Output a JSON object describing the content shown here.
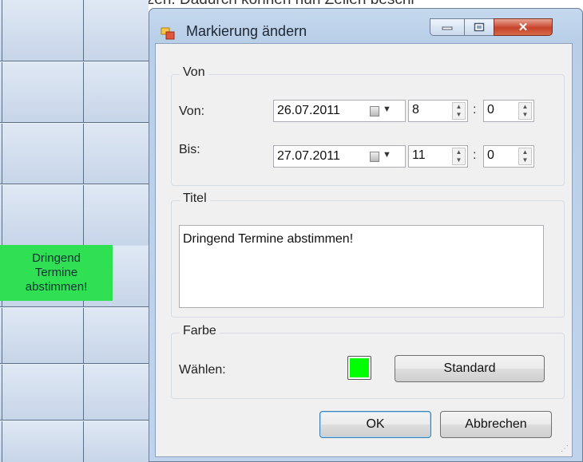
{
  "background": {
    "top_text": "Beschriftung zu benutzen. Dadurch können nun Zellen beschr",
    "event_lines": [
      "Dringend",
      "Termine",
      "abstimmen!"
    ],
    "event_color": "#2ee052"
  },
  "dialog": {
    "title": "Markierung ändern",
    "title_icon": "form-icon",
    "controls": {
      "minimize": "minimize-icon",
      "maximize": "maximize-icon",
      "close": "close-icon"
    },
    "von_group": {
      "label": "Von",
      "from_label": "Von:",
      "from_date": "26.07.2011",
      "from_hour": "8",
      "from_minute": "0",
      "to_label": "Bis:",
      "to_date": "27.07.2011",
      "to_hour": "11",
      "to_minute": "0",
      "separator": ":"
    },
    "title_group": {
      "label": "Titel",
      "text": "Dringend Termine abstimmen!"
    },
    "color_group": {
      "label": "Farbe",
      "choose_label": "Wählen:",
      "swatch_color": "#00ff00",
      "standard_button": "Standard"
    },
    "ok_button": "OK",
    "cancel_button": "Abbrechen"
  }
}
